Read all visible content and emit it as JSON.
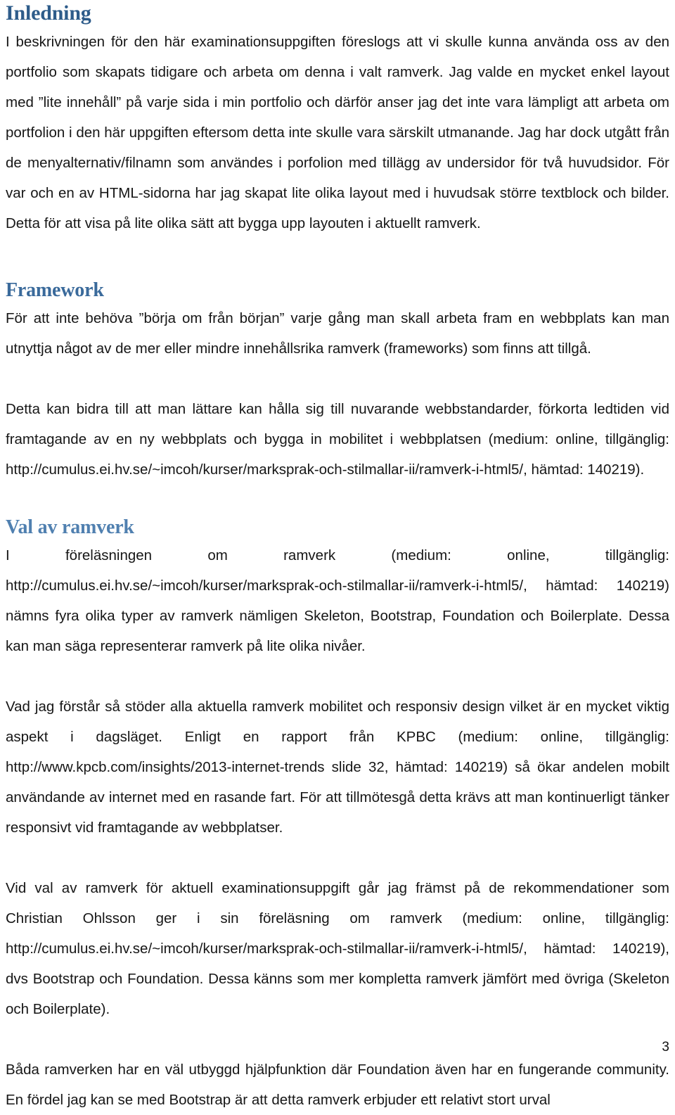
{
  "document": {
    "page_number": "3",
    "sections": [
      {
        "heading": "Inledning",
        "heading_color": "#2E5C8A",
        "paragraphs": [
          "I beskrivningen för den här examinationsuppgiften föreslogs att vi skulle kunna använda oss av den portfolio som skapats tidigare och arbeta om denna i valt ramverk. Jag valde en mycket enkel layout med ”lite innehåll” på varje sida i min portfolio och därför anser jag det inte vara lämpligt att arbeta om portfolion i den här uppgiften eftersom detta inte skulle vara särskilt utmanande. Jag har dock utgått från de menyalternativ/filnamn som användes i porfolion med tillägg av undersidor för två huvudsidor. För var och en av HTML-sidorna har jag skapat lite olika layout med i huvudsak större textblock och bilder. Detta för att visa på lite olika sätt att bygga upp layouten i aktuellt ramverk."
        ]
      },
      {
        "heading": "Framework",
        "heading_color": "#3A6A9B",
        "paragraphs": [
          "För att inte behöva ”börja om från början” varje gång man skall arbeta fram en webbplats kan man utnyttja något av de mer eller mindre innehållsrika ramverk (frameworks) som finns att tillgå.",
          "Detta kan bidra till att man lättare kan hålla sig till nuvarande webbstandarder, förkorta ledtiden vid framtagande av en ny webbplats och bygga in mobilitet i webbplatsen (medium: online, tillgänglig: http://cumulus.ei.hv.se/~imcoh/kurser/marksprak-och-stilmallar-ii/ramverk-i-html5/, hämtad: 140219)."
        ]
      },
      {
        "heading": "Val av ramverk",
        "heading_color": "#5080B0",
        "paragraphs": [
          "I föreläsningen om ramverk (medium: online, tillgänglig: http://cumulus.ei.hv.se/~imcoh/kurser/marksprak-och-stilmallar-ii/ramverk-i-html5/, hämtad: 140219) nämns fyra olika typer av ramverk nämligen Skeleton, Bootstrap, Foundation och Boilerplate. Dessa kan man säga representerar ramverk på lite olika nivåer.",
          "Vad jag förstår så stöder alla aktuella ramverk mobilitet och responsiv design vilket är en mycket viktig aspekt i dagsläget. Enligt en rapport från KPBC (medium: online, tillgänglig: http://www.kpcb.com/insights/2013-internet-trends slide 32, hämtad: 140219) så ökar andelen mobilt användande av internet med en rasande fart. För att tillmötesgå detta krävs att man kontinuerligt tänker responsivt vid framtagande av webbplatser.",
          "Vid val av ramverk för aktuell examinationsuppgift går jag främst på de rekommendationer som Christian Ohlsson ger i sin föreläsning om ramverk (medium: online, tillgänglig: http://cumulus.ei.hv.se/~imcoh/kurser/marksprak-och-stilmallar-ii/ramverk-i-html5/, hämtad: 140219), dvs Bootstrap och Foundation. Dessa känns som mer kompletta ramverk jämfört med övriga (Skeleton och Boilerplate).",
          "Båda ramverken har en väl utbyggd hjälpfunktion där Foundation även har en fungerande community. En fördel jag kan se med Bootstrap är att detta ramverk erbjuder ett relativt stort urval"
        ]
      }
    ]
  }
}
